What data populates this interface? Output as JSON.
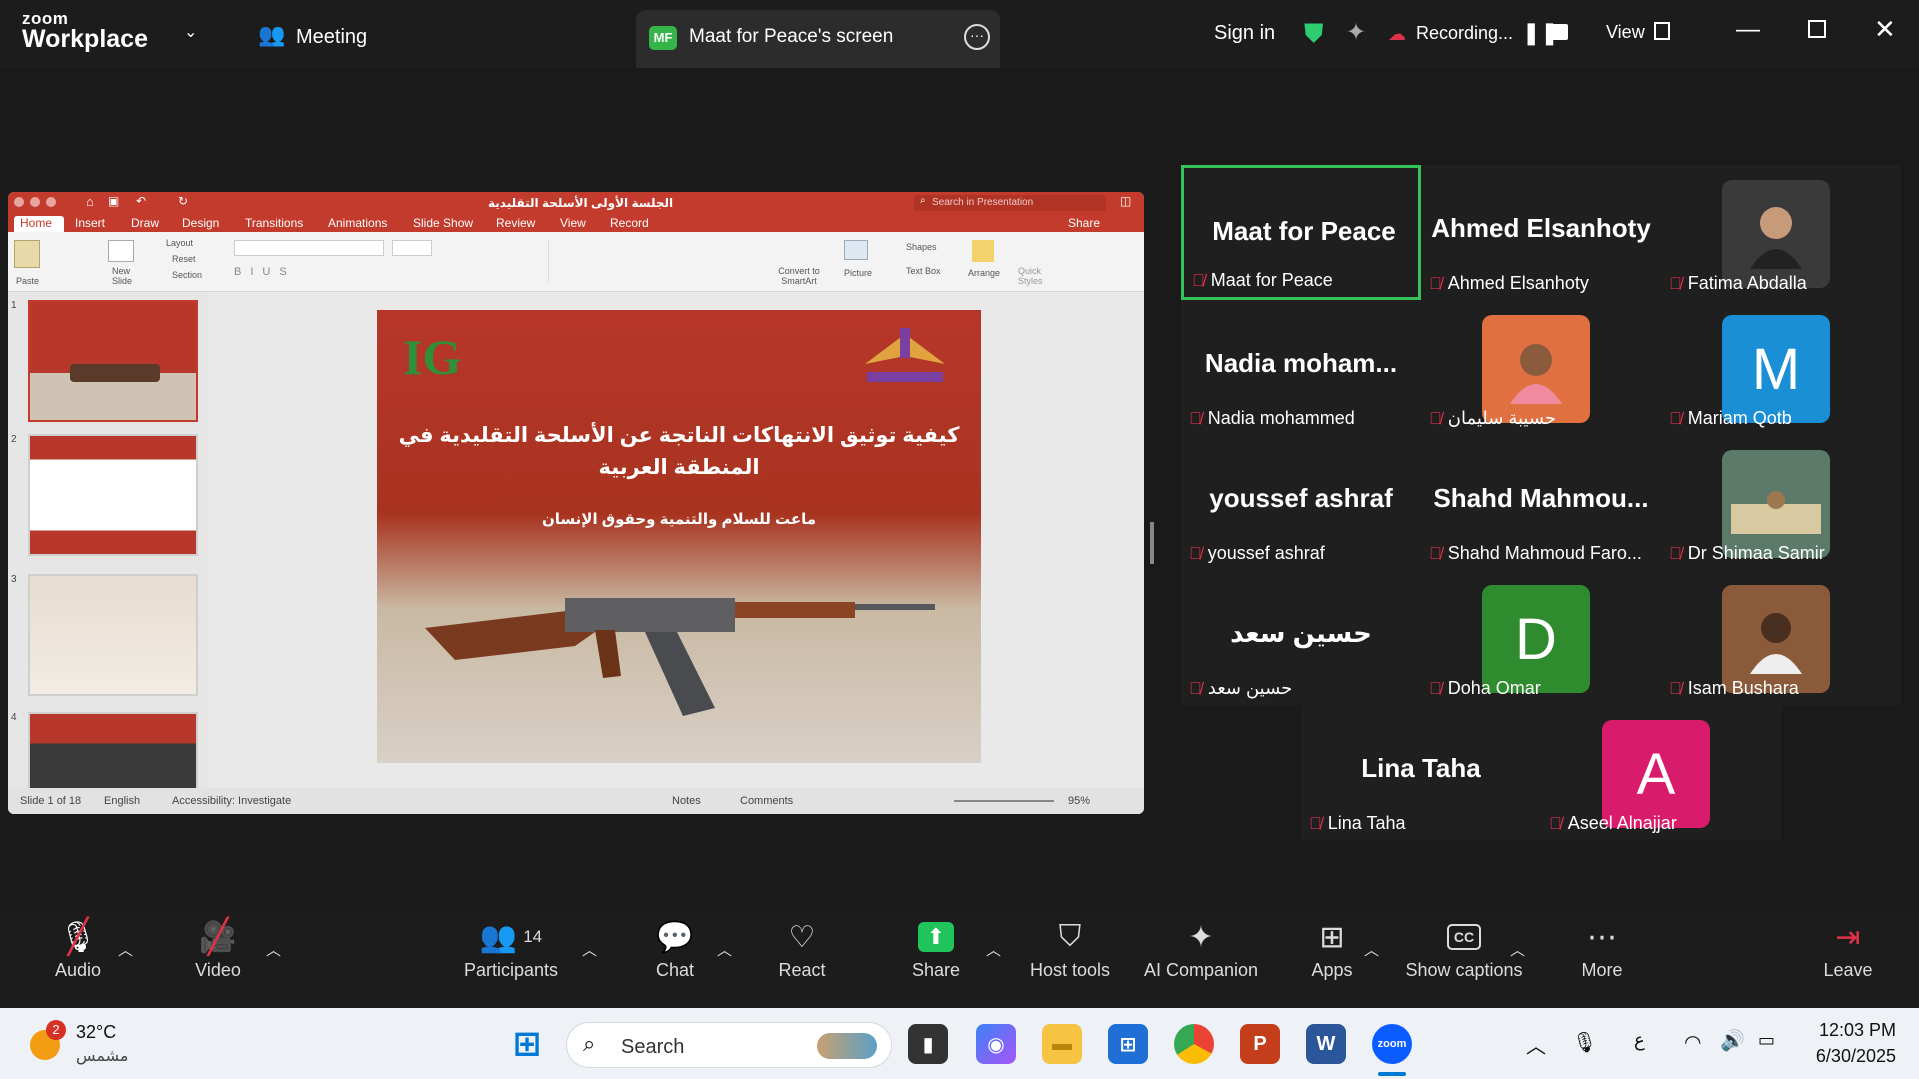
{
  "topbar": {
    "brand_line1": "zoom",
    "brand_line2": "Workplace",
    "meeting_label": "Meeting",
    "share_badge": "MF",
    "share_title": "Maat for Peace's screen",
    "sign_in": "Sign in",
    "recording": "Recording...",
    "view": "View"
  },
  "ppt": {
    "doc_title": "الجلسة الأولى الأسلحة التقليدية",
    "search_placeholder": "Search in Presentation",
    "share_btn": "Share",
    "menu": [
      "Home",
      "Insert",
      "Draw",
      "Design",
      "Transitions",
      "Animations",
      "Slide Show",
      "Review",
      "View",
      "Record"
    ],
    "ribbon": {
      "paste": "Paste",
      "new_slide": "New Slide",
      "layout": "Layout",
      "reset": "Reset",
      "section": "Section",
      "convert": "Convert to SmartArt",
      "picture": "Picture",
      "shapes": "Shapes",
      "textbox": "Text Box",
      "arrange": "Arrange",
      "quick_styles": "Quick Styles"
    },
    "thumb_numbers": [
      "1",
      "2",
      "3",
      "4"
    ],
    "slide": {
      "logo_text": "IG",
      "title_line1": "كيفية توثيق الانتهاكات الناتجة عن الأسلحة التقليدية في",
      "title_line2": "المنطقة العربية",
      "subtitle": "ماعت للسلام والتنمية وحقوق الإنسان"
    },
    "status": {
      "slide_of": "Slide 1 of 18",
      "language": "English",
      "accessibility": "Accessibility: Investigate",
      "notes": "Notes",
      "comments": "Comments",
      "zoom": "95%"
    }
  },
  "participants": [
    {
      "big": "Maat for Peace",
      "label": "Maat for Peace",
      "active": true
    },
    {
      "big": "Ahmed Elsanhoty",
      "label": "Ahmed Elsanhoty"
    },
    {
      "label": "Fatima Abdalla",
      "avatar_color": "#3a3a3a"
    },
    {
      "big": "Nadia  moham...",
      "label": "Nadia mohammed"
    },
    {
      "label": "حسيبة سليمان",
      "avatar_color": "#e07040"
    },
    {
      "label": "Mariam Qotb",
      "avatar_letter": "M",
      "avatar_color": "#1b8fd6"
    },
    {
      "big": "youssef ashraf",
      "label": "youssef ashraf"
    },
    {
      "big": "Shahd  Mahmou...",
      "label": "Shahd Mahmoud Faro..."
    },
    {
      "label": "Dr Shimaa Samir",
      "avatar_color": "#5c7a6a"
    },
    {
      "big": "حسين سعد",
      "label": "حسين سعد"
    },
    {
      "label": "Doha Omar",
      "avatar_letter": "D",
      "avatar_color": "#2e8b2e"
    },
    {
      "label": "Isam Bushara",
      "avatar_color": "#8a5a3a"
    },
    {
      "big": "Lina Taha",
      "label": "Lina Taha"
    },
    {
      "label": "Aseel Alnajjar",
      "avatar_letter": "A",
      "avatar_color": "#d81b6a"
    }
  ],
  "toolbar": {
    "audio": "Audio",
    "video": "Video",
    "participants": "Participants",
    "participants_count": "14",
    "chat": "Chat",
    "react": "React",
    "share": "Share",
    "host_tools": "Host tools",
    "ai_companion": "AI Companion",
    "apps": "Apps",
    "captions": "Show captions",
    "more": "More",
    "leave": "Leave"
  },
  "taskbar": {
    "weather_badge": "2",
    "temp": "32°C",
    "weather_desc": "مشمس",
    "search": "Search",
    "lang": "ع",
    "time": "12:03 PM",
    "date": "6/30/2025"
  }
}
